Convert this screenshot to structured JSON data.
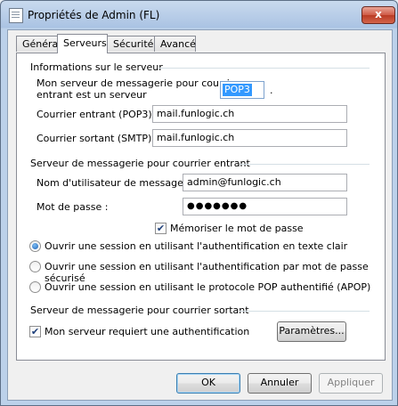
{
  "window": {
    "title": "Propriétés de Admin (FL)",
    "close_glyph": "x"
  },
  "tabs": [
    {
      "label": "Général"
    },
    {
      "label": "Serveurs",
      "active": true
    },
    {
      "label": "Sécurité"
    },
    {
      "label": "Avancé"
    }
  ],
  "server_info": {
    "title": "Informations sur le serveur",
    "incoming_type_label_1": "Mon serveur de messagerie pour courrier",
    "incoming_type_label_2": "entrant est un serveur",
    "incoming_type_value": "POP3",
    "incoming_type_suffix": ".",
    "incoming_label": "Courrier entrant (POP3) :",
    "incoming_value": "mail.funlogic.ch",
    "outgoing_label": "Courrier sortant (SMTP) :",
    "outgoing_value": "mail.funlogic.ch"
  },
  "incoming_server": {
    "title": "Serveur de messagerie pour courrier entrant",
    "username_label": "Nom d'utilisateur de messagerie :",
    "username_value": "admin@funlogic.ch",
    "password_label": "Mot de passe :",
    "password_value": "●●●●●●●",
    "remember_label": "Mémoriser le mot de passe",
    "remember_checked": true,
    "auth_options": [
      {
        "label": "Ouvrir une session en utilisant l'authentification en texte clair",
        "selected": true
      },
      {
        "label": "Ouvrir une session en utilisant l'authentification par mot de passe sécurisé",
        "selected": false
      },
      {
        "label": "Ouvrir une session en utilisant le protocole POP authentifié (APOP)",
        "selected": false
      }
    ]
  },
  "outgoing_server": {
    "title": "Serveur de messagerie pour courrier sortant",
    "requires_auth_label": "Mon serveur requiert une authentification",
    "requires_auth_checked": true,
    "settings_button": "Paramètres..."
  },
  "footer": {
    "ok": "OK",
    "cancel": "Annuler",
    "apply": "Appliquer"
  },
  "check_glyph": "✔"
}
